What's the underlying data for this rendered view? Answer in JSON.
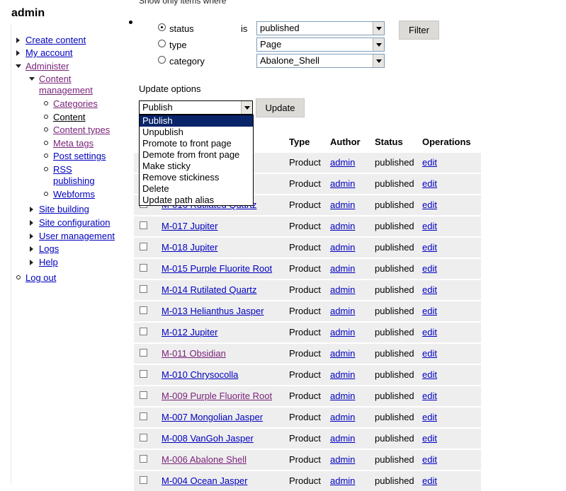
{
  "sidebar": {
    "username": "admin",
    "items": [
      {
        "label": "Create content"
      },
      {
        "label": "My account"
      },
      {
        "label": "Administer"
      },
      {
        "label": "Content management"
      },
      {
        "label": "Categories"
      },
      {
        "label": "Content"
      },
      {
        "label": "Content types"
      },
      {
        "label": "Meta tags"
      },
      {
        "label": "Post settings"
      },
      {
        "label": "RSS publishing"
      },
      {
        "label": "Webforms"
      },
      {
        "label": "Site building"
      },
      {
        "label": "Site configuration"
      },
      {
        "label": "User management"
      },
      {
        "label": "Logs"
      },
      {
        "label": "Help"
      },
      {
        "label": "Log out"
      }
    ]
  },
  "filter": {
    "heading": "Show only items where",
    "options": [
      {
        "label": "status",
        "selected": true
      },
      {
        "label": "type",
        "selected": false
      },
      {
        "label": "category",
        "selected": false
      }
    ],
    "is_label": "is",
    "status_value": "published",
    "type_value": "Page",
    "category_value": "Abalone_Shell",
    "button_label": "Filter"
  },
  "update": {
    "heading": "Update options",
    "selected": "Publish",
    "button_label": "Update",
    "options": [
      "Publish",
      "Unpublish",
      "Promote to front page",
      "Demote from front page",
      "Make sticky",
      "Remove stickiness",
      "Delete",
      "Update path alias"
    ]
  },
  "table": {
    "headers": {
      "type": "Type",
      "author": "Author",
      "status": "Status",
      "operations": "Operations"
    },
    "rows": [
      {
        "title": "",
        "type": "Product",
        "author": "admin",
        "status": "published",
        "op": "edit"
      },
      {
        "title": "",
        "type": "Product",
        "author": "admin",
        "status": "published",
        "op": "edit"
      },
      {
        "title": "M-016 Rutilated Quartz",
        "type": "Product",
        "author": "admin",
        "status": "published",
        "op": "edit"
      },
      {
        "title": "M-017 Jupiter",
        "type": "Product",
        "author": "admin",
        "status": "published",
        "op": "edit"
      },
      {
        "title": "M-018 Jupiter",
        "type": "Product",
        "author": "admin",
        "status": "published",
        "op": "edit"
      },
      {
        "title": "M-015 Purple Fluorite Root",
        "type": "Product",
        "author": "admin",
        "status": "published",
        "op": "edit"
      },
      {
        "title": "M-014 Rutilated Quartz",
        "type": "Product",
        "author": "admin",
        "status": "published",
        "op": "edit"
      },
      {
        "title": "M-013 Helianthus Jasper",
        "type": "Product",
        "author": "admin",
        "status": "published",
        "op": "edit"
      },
      {
        "title": "M-012 Jupiter",
        "type": "Product",
        "author": "admin",
        "status": "published",
        "op": "edit"
      },
      {
        "title": "M-011 Obsidian",
        "type": "Product",
        "author": "admin",
        "status": "published",
        "op": "edit"
      },
      {
        "title": "M-010 Chrysocolla",
        "type": "Product",
        "author": "admin",
        "status": "published",
        "op": "edit"
      },
      {
        "title": "M-009 Purple Fluorite Root",
        "type": "Product",
        "author": "admin",
        "status": "published",
        "op": "edit"
      },
      {
        "title": "M-007 Mongolian Jasper",
        "type": "Product",
        "author": "admin",
        "status": "published",
        "op": "edit"
      },
      {
        "title": "M-008 VanGoh Jasper",
        "type": "Product",
        "author": "admin",
        "status": "published",
        "op": "edit"
      },
      {
        "title": "M-006 Abalone Shell",
        "type": "Product",
        "author": "admin",
        "status": "published",
        "op": "edit"
      },
      {
        "title": "M-004 Ocean Jasper",
        "type": "Product",
        "author": "admin",
        "status": "published",
        "op": "edit"
      }
    ]
  },
  "colors": {
    "link": "#0000c0",
    "visited_link": "#7a237a",
    "row_bg": "#eeeeee",
    "highlight": "#0a246a"
  }
}
